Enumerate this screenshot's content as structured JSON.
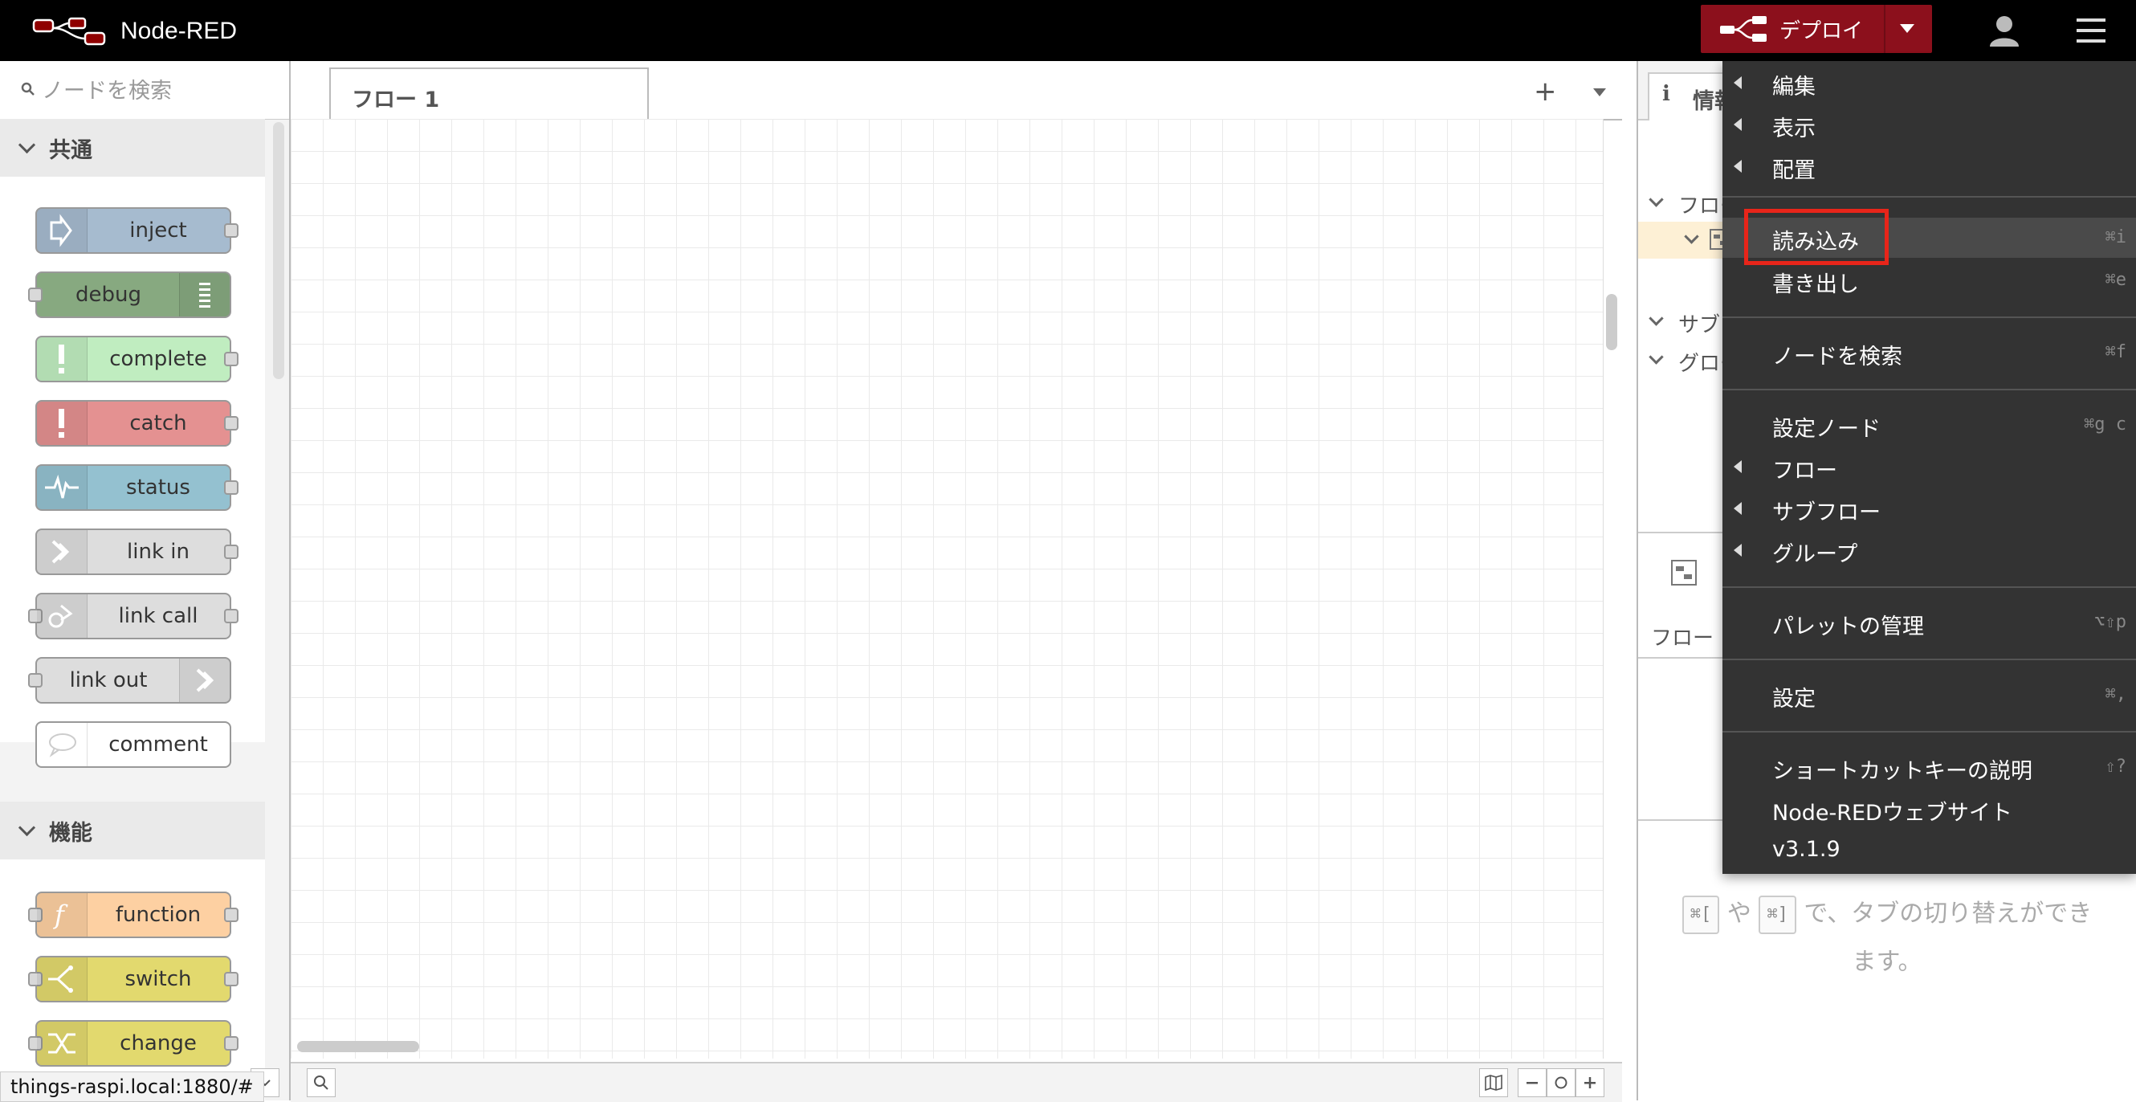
{
  "header": {
    "app_title": "Node-RED",
    "deploy_label": "デプロイ",
    "colors": {
      "header_bg": "#000000",
      "deploy_bg": "#8c101c"
    }
  },
  "palette": {
    "search_placeholder": "ノードを検索",
    "categories": [
      {
        "label": "共通",
        "nodes": [
          {
            "label": "inject",
            "color": "#a6bbcf",
            "icon": "inject-arrow-icon"
          },
          {
            "label": "debug",
            "color": "#87a980",
            "icon": "debug-list-icon"
          },
          {
            "label": "complete",
            "color": "#c0edc0",
            "icon": "exclamation-icon"
          },
          {
            "label": "catch",
            "color": "#e49191",
            "icon": "exclamation-icon"
          },
          {
            "label": "status",
            "color": "#94c1d0",
            "icon": "pulse-icon"
          },
          {
            "label": "link in",
            "color": "#dddddd",
            "icon": "link-in-icon"
          },
          {
            "label": "link call",
            "color": "#dddddd",
            "icon": "link-call-icon"
          },
          {
            "label": "link out",
            "color": "#dddddd",
            "icon": "link-out-icon"
          },
          {
            "label": "comment",
            "color": "#ffffff",
            "icon": "comment-bubble-icon"
          }
        ]
      },
      {
        "label": "機能",
        "nodes": [
          {
            "label": "function",
            "color": "#fdd0a2",
            "icon": "function-icon"
          },
          {
            "label": "switch",
            "color": "#e2d96e",
            "icon": "switch-icon"
          },
          {
            "label": "change",
            "color": "#e2d96e",
            "icon": "change-icon"
          }
        ]
      }
    ]
  },
  "workspace": {
    "tabs": [
      {
        "label": "フロー 1"
      }
    ],
    "add_tab_symbol": "+"
  },
  "status_bar": {
    "url": "things-raspi.local:1880/#"
  },
  "sidebar": {
    "tab_label": "情報",
    "tree_labels": [
      "フロー",
      "サブ",
      "グロー"
    ],
    "section_label": "フロー",
    "help": {
      "key1": "⌘[",
      "middle": "や",
      "key2": "⌘]",
      "text": "で、タブの切り替えができます。"
    }
  },
  "menu": {
    "items": [
      {
        "label": "編集",
        "submenu": true,
        "shortcut": ""
      },
      {
        "label": "表示",
        "submenu": true,
        "shortcut": ""
      },
      {
        "label": "配置",
        "submenu": true,
        "shortcut": ""
      },
      {
        "label": "読み込み",
        "submenu": false,
        "shortcut": "⌘i",
        "highlighted": true
      },
      {
        "label": "書き出し",
        "submenu": false,
        "shortcut": "⌘e"
      },
      {
        "label": "ノードを検索",
        "submenu": false,
        "shortcut": "⌘f"
      },
      {
        "label": "設定ノード",
        "submenu": false,
        "shortcut": "⌘g c"
      },
      {
        "label": "フロー",
        "submenu": true,
        "shortcut": ""
      },
      {
        "label": "サブフロー",
        "submenu": true,
        "shortcut": ""
      },
      {
        "label": "グループ",
        "submenu": true,
        "shortcut": ""
      },
      {
        "label": "パレットの管理",
        "submenu": false,
        "shortcut": "⌥⇧p"
      },
      {
        "label": "設定",
        "submenu": false,
        "shortcut": "⌘,"
      },
      {
        "label": "ショートカットキーの説明",
        "submenu": false,
        "shortcut": "⇧?"
      },
      {
        "label": "Node-REDウェブサイト",
        "submenu": false,
        "shortcut": ""
      },
      {
        "label": "v3.1.9",
        "submenu": false,
        "shortcut": ""
      }
    ],
    "highlight_color": "#e8251a"
  }
}
